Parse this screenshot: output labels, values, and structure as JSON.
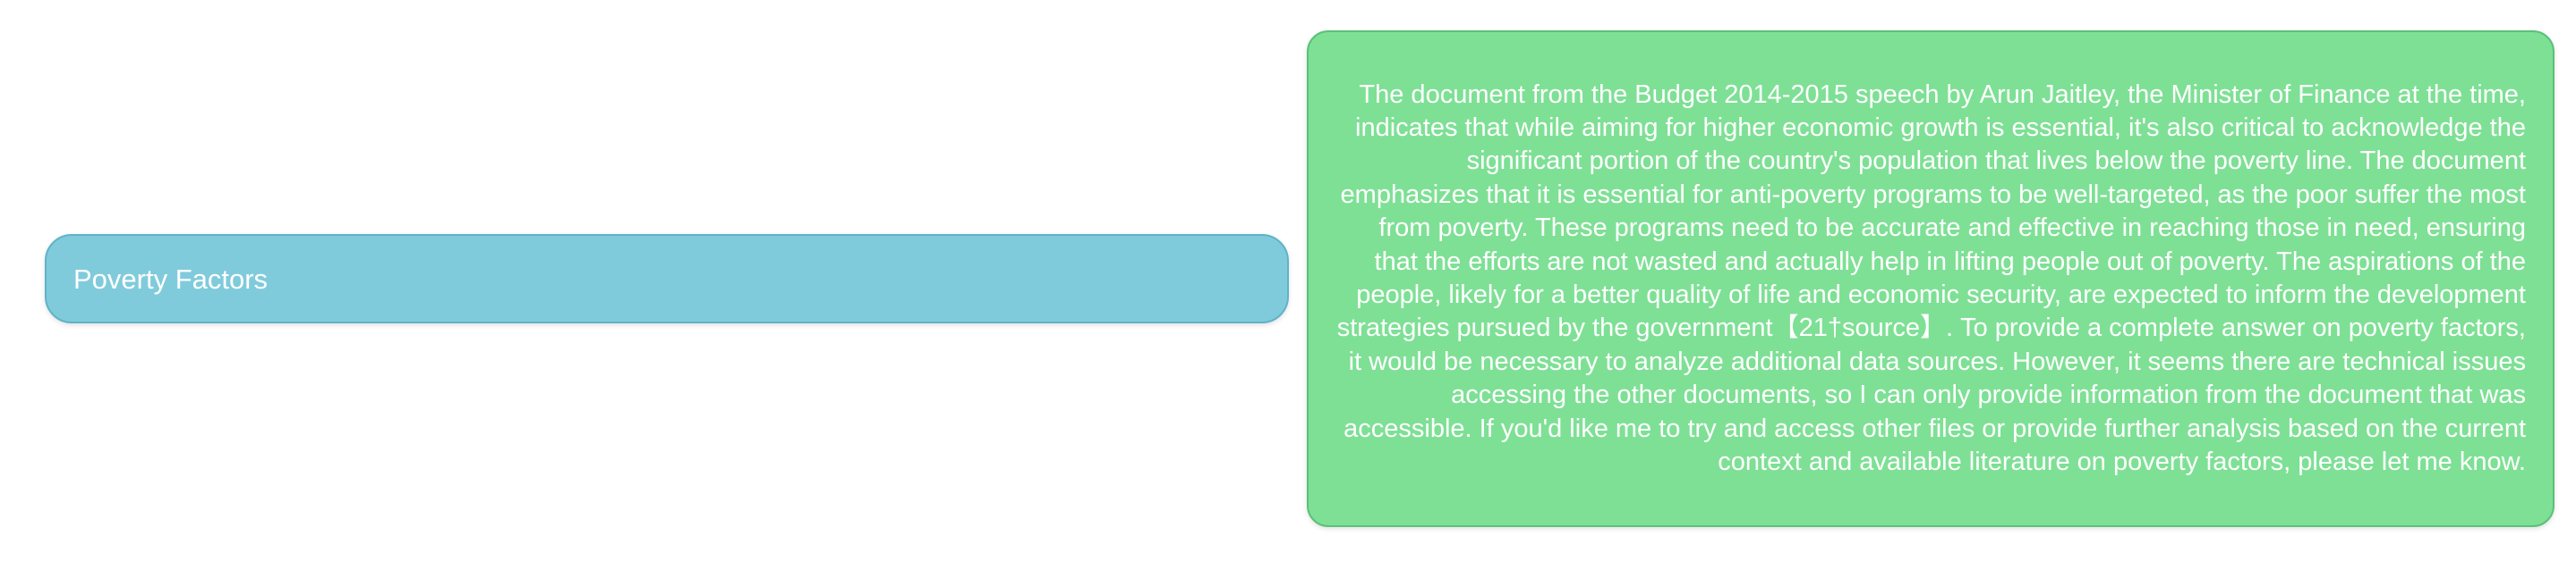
{
  "nodes": {
    "topic": {
      "label": "Poverty Factors"
    },
    "answer": {
      "text": "The document from the Budget 2014-2015 speech by Arun Jaitley, the Minister of Finance at the time, indicates that while aiming for higher economic growth is essential, it's also critical to acknowledge the significant portion of the country's population that lives below the poverty line. The document emphasizes that it is essential for anti-poverty programs to be well-targeted, as the poor suffer the most from poverty. These programs need to be accurate and effective in reaching those in need, ensuring that the efforts are not wasted and actually help in lifting people out of poverty. The aspirations of the people, likely for a better quality of life and economic security, are expected to inform the development strategies pursued by the government【21†source】. To provide a complete answer on poverty factors, it would be necessary to analyze additional data sources. However, it seems there are technical issues accessing the other documents, so I can only provide information from the document that was accessible. If you'd like me to try and access other files or provide further analysis based on the current context and available literature on poverty factors, please let me know."
    }
  },
  "colors": {
    "topic_fill": "#80cbdb",
    "answer_fill": "#7ee095",
    "text": "#ffffff"
  }
}
